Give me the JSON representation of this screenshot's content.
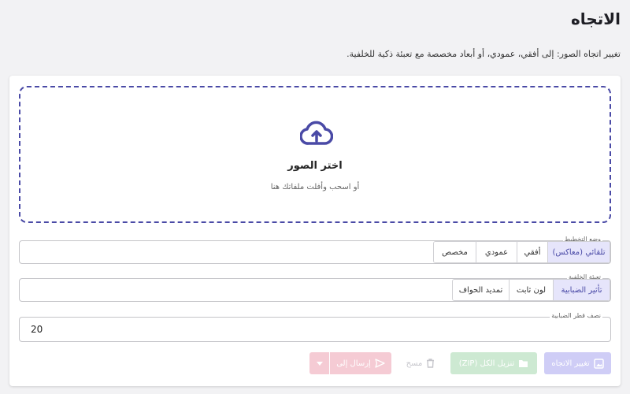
{
  "page": {
    "title": "الاتجاه",
    "description": "تغيير اتجاه الصور: إلى أفقي، عمودي، أو أبعاد مخصصة مع تعبئة ذكية للخلفية."
  },
  "dropzone": {
    "icon": "cloud-upload-icon",
    "title": "اختر الصور",
    "subtitle": "أو اسحب وأفلت ملفاتك هنا"
  },
  "mode": {
    "legend": "وضع التخطيط",
    "options": [
      "تلقائي (معاكس)",
      "أفقي",
      "عمودي",
      "مخصص"
    ],
    "selected": "تلقائي (معاكس)"
  },
  "fill": {
    "legend": "تعبئة الخلفية",
    "options": [
      "تأثير الضبابية",
      "لون ثابت",
      "تمديد الحواف"
    ],
    "selected": "تأثير الضبابية"
  },
  "blur": {
    "legend": "نصف قطر الضبابية",
    "value": "20"
  },
  "actions": {
    "orient_label": "تغيير الاتجاه",
    "zip_label": "تنزيل الكل (ZIP)",
    "clear_label": "مسح",
    "send_label": "إرسال إلى"
  },
  "colors": {
    "accent": "#4a4aa6",
    "active_toggle_bg": "#e6e5fb",
    "orient_button": "#cfcdf6",
    "zip_button": "#cde9d2",
    "send_button": "#f5cbd4"
  }
}
